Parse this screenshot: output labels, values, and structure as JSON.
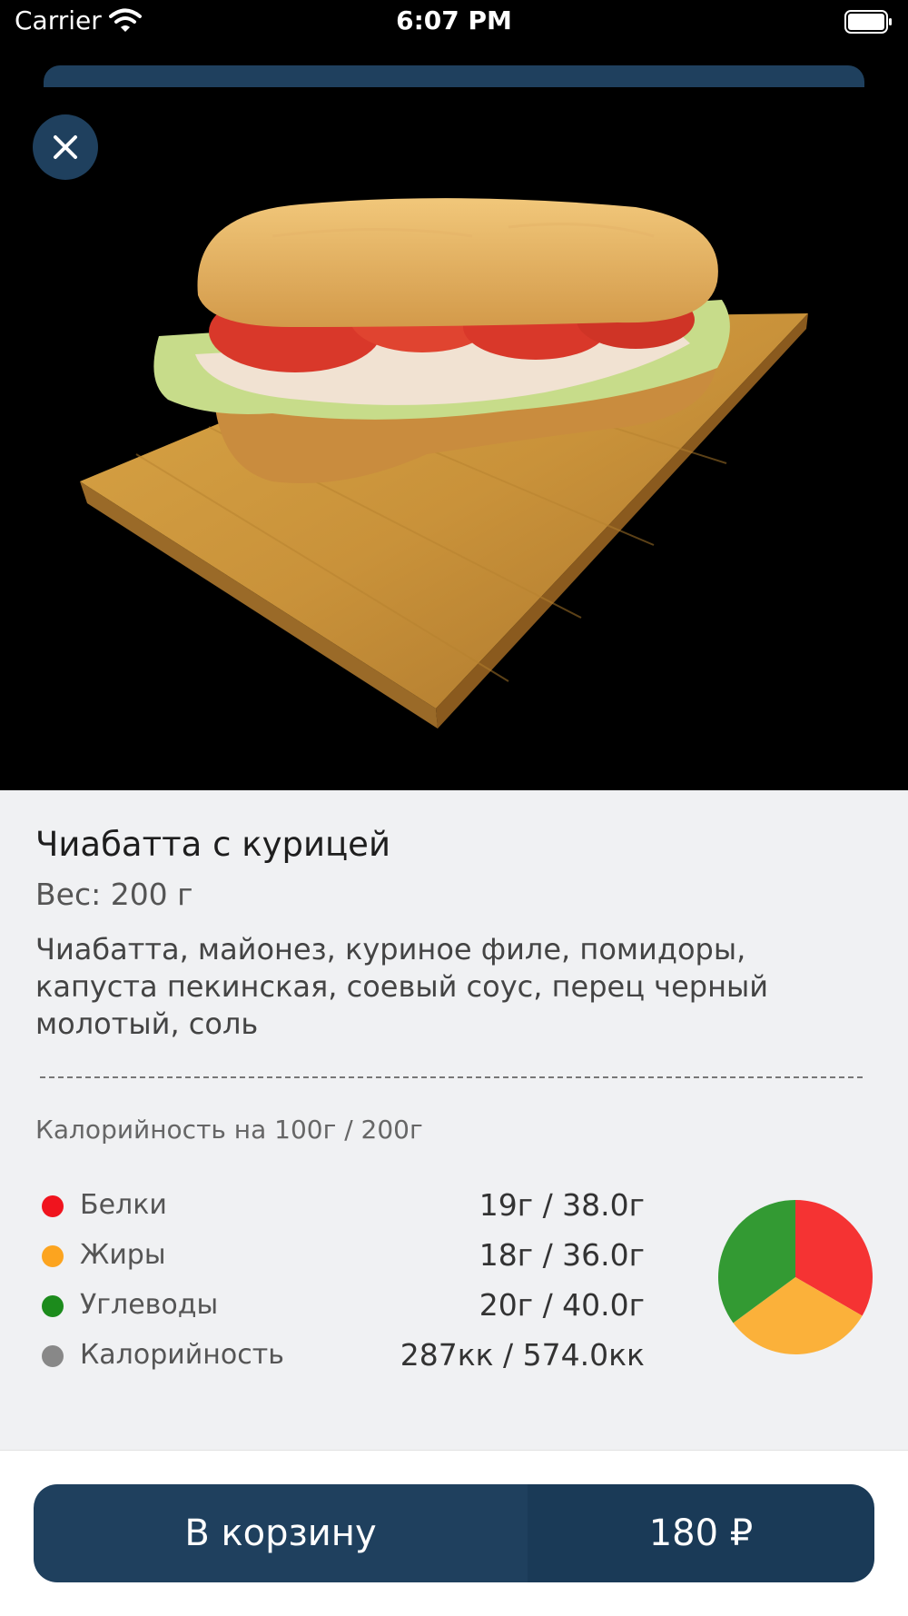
{
  "status_bar": {
    "carrier": "Carrier",
    "time": "6:07 PM"
  },
  "hero": {
    "image": "sandwich-on-cutting-board",
    "close_icon": "close-icon"
  },
  "product": {
    "title": "Чиабатта с курицей",
    "weight": "Вес: 200 г",
    "description": "Чиабатта, майонез, куриное филе, помидоры, капуста пекинская, соевый соус, перец черный молотый, соль"
  },
  "nutrition": {
    "heading": "Калорийность на 100г / 200г",
    "rows": [
      {
        "label": "Белки",
        "value": "19г / 38.0г",
        "color": "#f0141e"
      },
      {
        "label": "Жиры",
        "value": "18г / 36.0г",
        "color": "#fca41f"
      },
      {
        "label": "Углеводы",
        "value": "20г / 40.0г",
        "color": "#1c8b1c"
      },
      {
        "label": "Калорийность",
        "value": "287кк / 574.0кк",
        "color": "#888888"
      }
    ]
  },
  "chart_data": {
    "type": "pie",
    "categories": [
      "Белки",
      "Жиры",
      "Углеводы"
    ],
    "values": [
      19,
      18,
      20
    ],
    "colors": [
      "#f53333",
      "#fbb13a",
      "#339a33"
    ]
  },
  "cart": {
    "label": "В корзину",
    "price": "180 ₽"
  },
  "colors": {
    "brand": "#1f405e",
    "background": "#f0f1f3"
  }
}
